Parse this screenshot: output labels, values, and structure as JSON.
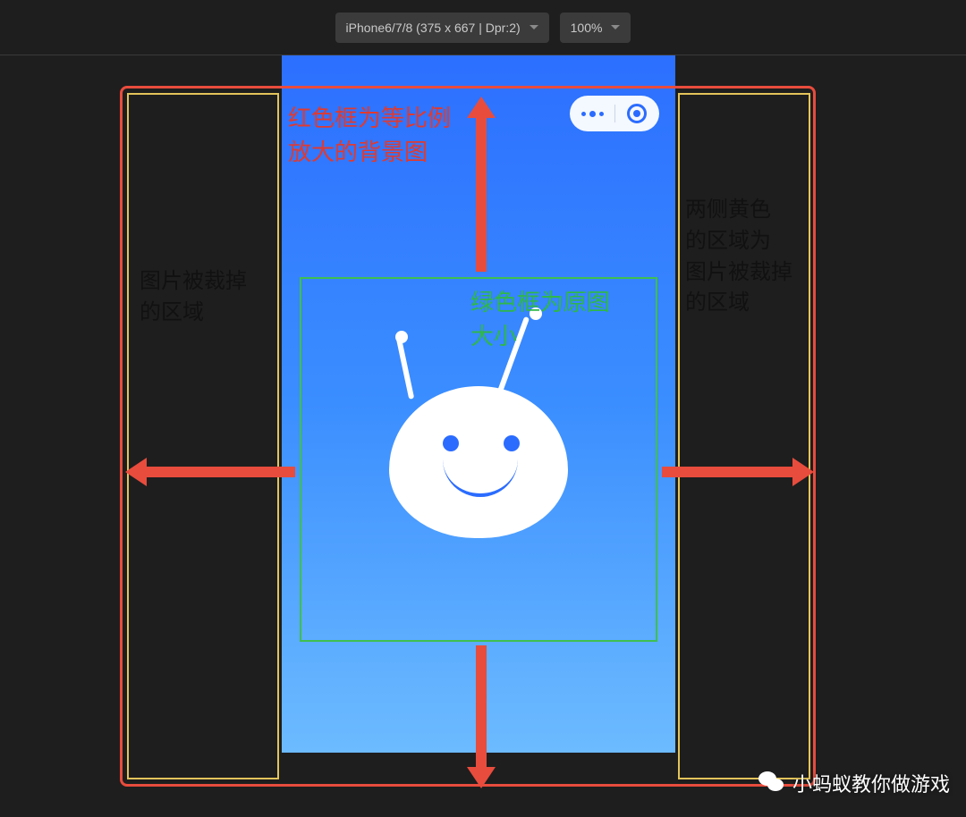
{
  "toolbar": {
    "device_label": "iPhone6/7/8 (375 x 667 | Dpr:2)",
    "zoom_label": "100%"
  },
  "annotations": {
    "red_box_label": "红色框为等比例\n放大的背景图",
    "green_box_label": "绿色框为原图\n大小",
    "crop_left_label": "图片被裁掉\n的区域",
    "crop_right_label": "两侧黄色\n的区域为\n图片被裁掉\n的区域"
  },
  "watermark": {
    "text": "小蚂蚁教你做游戏"
  }
}
